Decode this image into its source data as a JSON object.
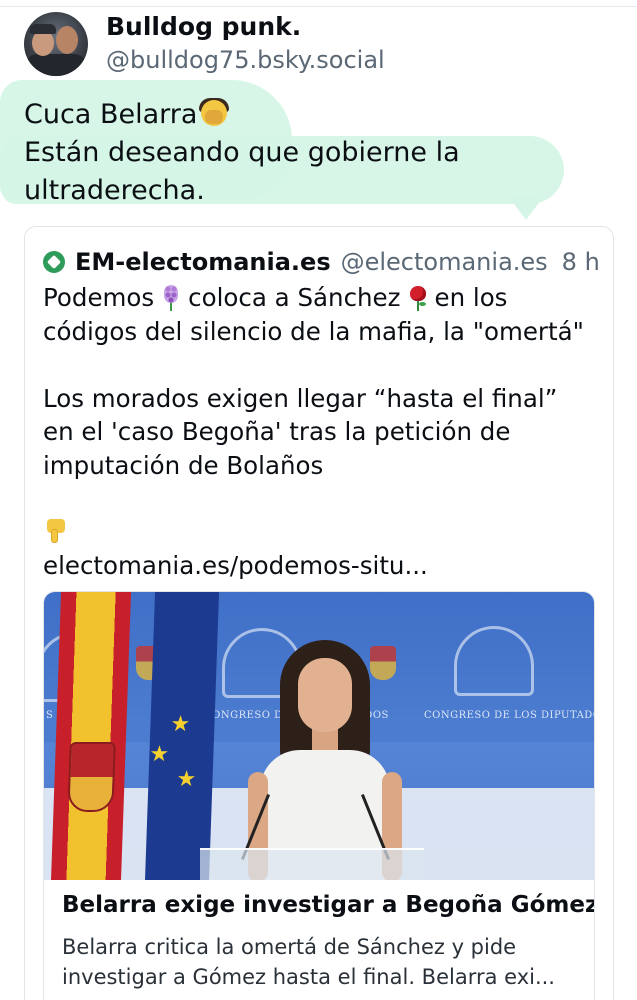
{
  "author": {
    "name": "Bulldog punk.",
    "handle": "@bulldog75.bsky.social",
    "avatar_icon": "profile-photo"
  },
  "post": {
    "line1": "Cuca Belarra",
    "line1_emoji": "facepalm-emoji",
    "line2": "Están deseando que gobierne la",
    "line3": "ultraderecha.",
    "highlight_color": "#d5f6e6"
  },
  "quote": {
    "name": "EM-electomania.es",
    "handle": "@electomania.es",
    "time": "8 h",
    "text_l1a": "Podemos",
    "text_l1b": "coloca a Sánchez",
    "text_l1c": "en los",
    "text_l2": "códigos del silencio de la mafia, la \"omertá\"",
    "text_l3": "Los morados exigen llegar “hasta el final”",
    "text_l4": "en el 'caso Begoña' tras la petición de",
    "text_l5": "imputación de Bolaños",
    "link": "electomania.es/podemos-situ...",
    "accent_color": "#2e9b5a"
  },
  "preview": {
    "photo_text_1": "CONGRESO DE LOS DIPUTADOS",
    "photo_text_2": "CONGRESO DE LOS DIPUTADOS",
    "photo_text_3": "S DIPUT",
    "title": "Belarra exige investigar a Begoña Gómez",
    "desc_l1": "Belarra critica la omertá de Sánchez y pide",
    "desc_l2": "investigar a Gómez hasta el final. Belarra exi..."
  }
}
